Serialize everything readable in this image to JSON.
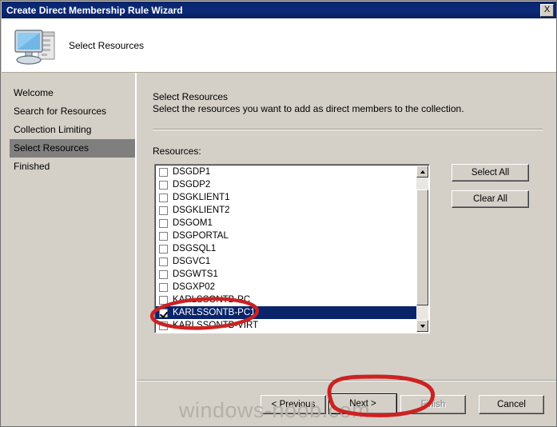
{
  "window": {
    "title": "Create Direct Membership Rule Wizard",
    "close_label": "X"
  },
  "banner": {
    "heading": "Select Resources",
    "icon": "computer-icon"
  },
  "sidebar": {
    "items": [
      {
        "label": "Welcome",
        "active": false
      },
      {
        "label": "Search for Resources",
        "active": false
      },
      {
        "label": "Collection Limiting",
        "active": false
      },
      {
        "label": "Select Resources",
        "active": true
      },
      {
        "label": "Finished",
        "active": false
      }
    ]
  },
  "main": {
    "title": "Select Resources",
    "description": "Select the resources you want to add as direct members to the collection.",
    "resources_label": "Resources:",
    "resources": [
      {
        "name": "DSGDP1",
        "checked": false,
        "selected": false
      },
      {
        "name": "DSGDP2",
        "checked": false,
        "selected": false
      },
      {
        "name": "DSGKLIENT1",
        "checked": false,
        "selected": false
      },
      {
        "name": "DSGKLIENT2",
        "checked": false,
        "selected": false
      },
      {
        "name": "DSGOM1",
        "checked": false,
        "selected": false
      },
      {
        "name": "DSGPORTAL",
        "checked": false,
        "selected": false
      },
      {
        "name": "DSGSQL1",
        "checked": false,
        "selected": false
      },
      {
        "name": "DSGVC1",
        "checked": false,
        "selected": false
      },
      {
        "name": "DSGWTS1",
        "checked": false,
        "selected": false
      },
      {
        "name": "DSGXP02",
        "checked": false,
        "selected": false
      },
      {
        "name": "KARLSSONTB-PC",
        "checked": false,
        "selected": false
      },
      {
        "name": "KARLSSONTB-PC1",
        "checked": true,
        "selected": true
      },
      {
        "name": "KARLSSONTB-VIRT",
        "checked": false,
        "selected": false
      }
    ],
    "select_all_label": "Select All",
    "clear_all_label": "Clear All"
  },
  "footer": {
    "previous_label": "< Previous",
    "next_label": "Next >",
    "finish_label": "Finish",
    "cancel_label": "Cancel"
  },
  "watermark": {
    "text": "windows-noob.com"
  },
  "colors": {
    "titlebar": "#0a246a",
    "selection": "#0a246a",
    "face": "#d4d0c8",
    "annotation": "#cc2222",
    "sidebar_active": "#7f7f7f"
  }
}
